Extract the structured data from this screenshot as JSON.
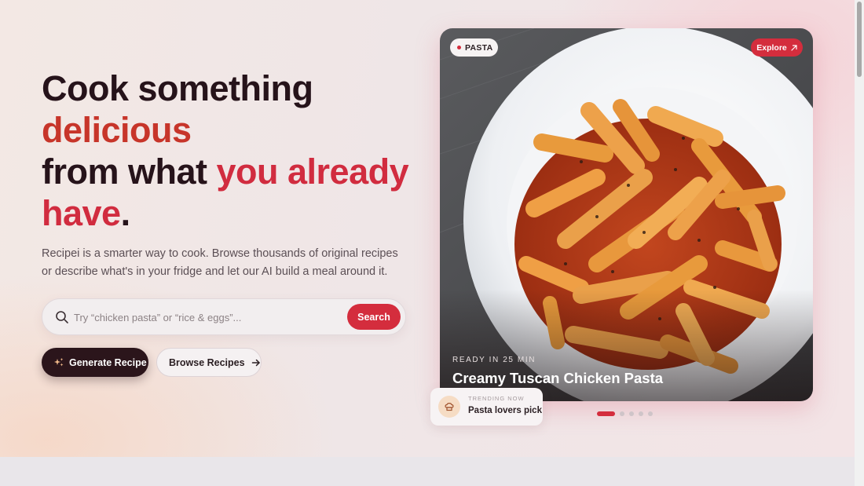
{
  "hero": {
    "headline": {
      "line1": "Cook something",
      "line2": "delicious",
      "line3_start": "from what ",
      "line3_accent": "you already",
      "line4_accent": "have",
      "line4_end": "."
    },
    "subtitle": "Recipei is a smarter way to cook. Browse thousands of original recipes or describe what's in your fridge and let our AI build a meal around it.",
    "search": {
      "placeholder": "Try “chicken pasta” or “rice & eggs”...",
      "value": "",
      "button_label": "Search"
    },
    "buttons": {
      "generate_label": "Generate Recipe",
      "browse_label": "Browse Recipes"
    }
  },
  "featured_card": {
    "tag": "PASTA",
    "explore_label": "Explore",
    "ready_text": "READY IN 25 MIN",
    "title": "Creamy Tuscan Chicken Pasta"
  },
  "trending": {
    "small_label": "TRENDING NOW",
    "label": "Pasta lovers pick"
  },
  "carousel": {
    "total": 5,
    "active_index": 0
  },
  "colors": {
    "brand_red": "#d42d3d",
    "accent_orange": "#c7352a",
    "dark": "#2b151b"
  }
}
